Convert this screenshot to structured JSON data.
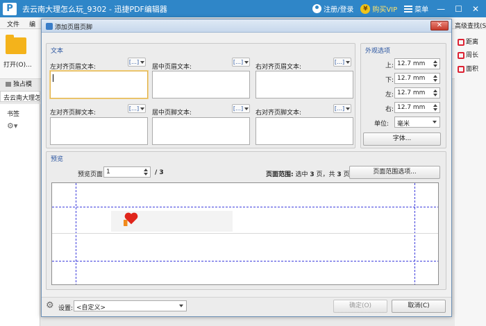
{
  "app": {
    "title": "去云南大理怎么玩_9302 - 迅捷PDF编辑器",
    "logo_letter": "P",
    "login_label": "注册/登录",
    "vip_label": "购买VIP",
    "coin_glyph": "¥",
    "menu_label": "菜单",
    "win_min": "—",
    "win_max": "☐",
    "win_close": "✕",
    "menu_file": "文件",
    "menu_edit": "编",
    "open_label": "打开(O)...",
    "exclusive_label": "独占模",
    "doc_tab": "去云南大理怎么玩",
    "bookmarks_label": "书签",
    "advanced_search": "高级查找(S)",
    "right_items": [
      "距离",
      "周长",
      "面积"
    ]
  },
  "dialog": {
    "title": "添加页眉页脚",
    "close_glyph": "✕",
    "text_group_title": "文本",
    "appearance_group_title": "外观选项",
    "preview_group_title": "预览",
    "insert_glyph": "[…]",
    "header_labels": [
      "左对齐页眉文本:",
      "居中页眉文本:",
      "右对齐页眉文本:"
    ],
    "footer_labels": [
      "左对齐页脚文本:",
      "居中页脚文本:",
      "右对齐页脚文本:"
    ],
    "margins": {
      "top_label": "上:",
      "top_value": "12.7 mm",
      "bottom_label": "下:",
      "bottom_value": "12.7 mm",
      "left_label": "左:",
      "left_value": "12.7 mm",
      "right_label": "右:",
      "right_value": "12.7 mm"
    },
    "unit_label": "单位:",
    "unit_value": "毫米",
    "font_button": "字体...",
    "preview_page_label": "预览页面",
    "preview_page_value": "1",
    "preview_page_total": "/ 3",
    "page_range_label": "页面范围:",
    "page_range_text_1": "选中",
    "page_range_selected": "3",
    "page_range_text_2": "页，共",
    "page_range_total": "3",
    "page_range_text_3": "页",
    "page_range_button": "页面范围选项...",
    "settings_label": "设置:",
    "settings_value": "<自定义>",
    "ok_button": "确定(O)",
    "cancel_button": "取消(C)"
  }
}
